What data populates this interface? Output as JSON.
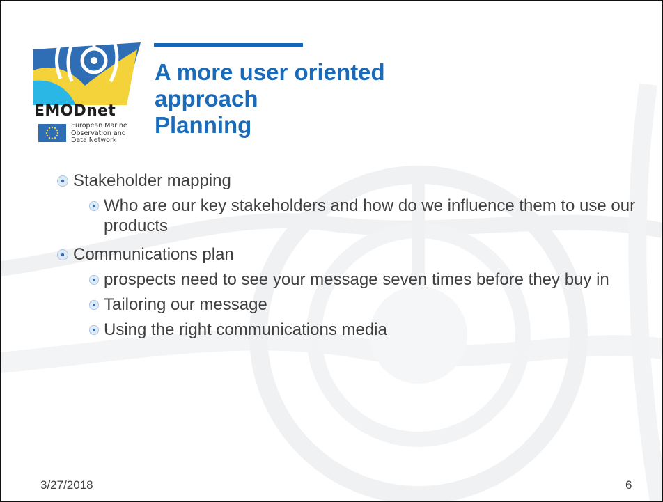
{
  "logo": {
    "wordmark": "EMODnet",
    "subtitle_lines": [
      "European Marine",
      "Observation and",
      "Data Network"
    ]
  },
  "title_lines": [
    "A more user oriented",
    "approach",
    "Planning"
  ],
  "bullets": [
    {
      "text": "Stakeholder mapping",
      "children": [
        "Who are our key stakeholders and how do we influence them to use our products"
      ]
    },
    {
      "text": "Communications plan",
      "children": [
        "prospects need to see your message seven times before they buy in",
        "Tailoring our message",
        "Using the right communications media"
      ]
    }
  ],
  "footer": {
    "date": "3/27/2018",
    "page_number": "6"
  },
  "colors": {
    "title": "#1b6bb8",
    "title_bar": "#1565b8",
    "body_text": "#404040",
    "logo_blue": "#2f6eb5",
    "logo_cyan": "#2ab7e6",
    "logo_yellow": "#f3d23a"
  }
}
